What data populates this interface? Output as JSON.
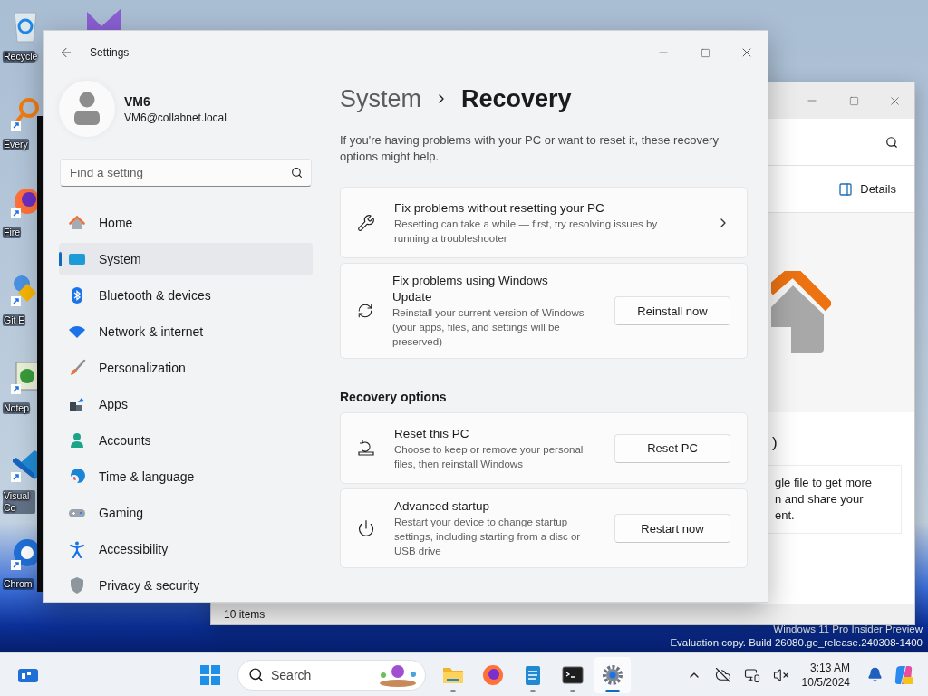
{
  "desktop": {
    "icons": [
      {
        "label": "Recycle"
      },
      {
        "label": "Every"
      },
      {
        "label": "Fire"
      },
      {
        "label": "Git E"
      },
      {
        "label": "Notep"
      },
      {
        "label": "Visual Co"
      },
      {
        "label": "Chrom"
      }
    ],
    "watermark": [
      "Windows 11 Pro Insider Preview",
      "Evaluation copy. Build 26080.ge_release.240308-1400"
    ]
  },
  "explorer": {
    "details_button": "Details",
    "heading": ")",
    "card_lines": [
      "gle file to get more",
      "n and share your",
      "ent."
    ],
    "status": "10 items"
  },
  "settings": {
    "title": "Settings",
    "user": {
      "name": "VM6",
      "email": "VM6@collabnet.local"
    },
    "search": {
      "placeholder": "Find a setting"
    },
    "nav": [
      {
        "label": "Home",
        "selected": false
      },
      {
        "label": "System",
        "selected": true
      },
      {
        "label": "Bluetooth & devices",
        "selected": false
      },
      {
        "label": "Network & internet",
        "selected": false
      },
      {
        "label": "Personalization",
        "selected": false
      },
      {
        "label": "Apps",
        "selected": false
      },
      {
        "label": "Accounts",
        "selected": false
      },
      {
        "label": "Time & language",
        "selected": false
      },
      {
        "label": "Gaming",
        "selected": false
      },
      {
        "label": "Accessibility",
        "selected": false
      },
      {
        "label": "Privacy & security",
        "selected": false
      }
    ],
    "breadcrumb": {
      "parent": "System",
      "current": "Recovery"
    },
    "description": "If you're having problems with your PC or want to reset it, these recovery options might help.",
    "cards": [
      {
        "kind": "link",
        "title": "Fix problems without resetting your PC",
        "description": "Resetting can take a while — first, try resolving issues by running a troubleshooter"
      },
      {
        "kind": "button",
        "title": "Fix problems using Windows Update",
        "description": "Reinstall your current version of Windows (your apps, files, and settings will be preserved)",
        "button": "Reinstall now"
      }
    ],
    "recovery_options": {
      "heading": "Recovery options",
      "cards": [
        {
          "kind": "button",
          "title": "Reset this PC",
          "description": "Choose to keep or remove your personal files, then reinstall Windows",
          "button": "Reset PC"
        },
        {
          "kind": "button",
          "title": "Advanced startup",
          "description": "Restart your device to change startup settings, including starting from a disc or USB drive",
          "button": "Restart now"
        }
      ]
    }
  },
  "taskbar": {
    "search": {
      "placeholder": "Search"
    },
    "apps": [
      {
        "running": true,
        "selected": false
      },
      {
        "running": false,
        "selected": false
      },
      {
        "running": true,
        "selected": false
      },
      {
        "running": true,
        "selected": false
      },
      {
        "running": true,
        "selected": true
      }
    ],
    "clock": {
      "time": "3:13 AM",
      "date": "10/5/2024"
    }
  }
}
